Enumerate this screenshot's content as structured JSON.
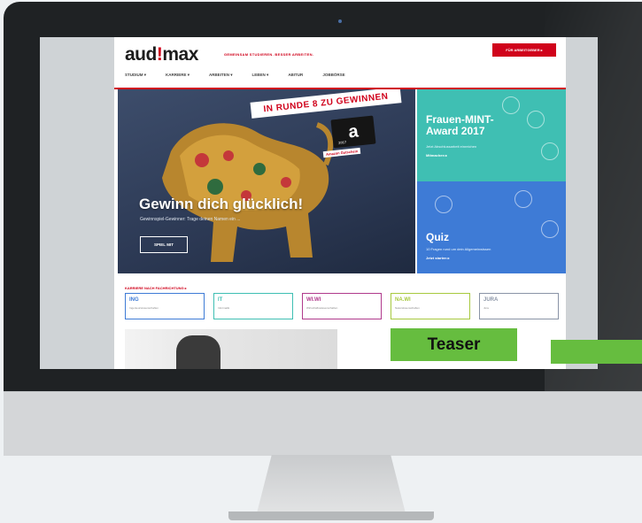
{
  "site": {
    "logo_main": "aud",
    "logo_bang": "!",
    "logo_end": "max",
    "tagline": "GEMEINSAM STUDIEREN. BESSER ARBEITEN.",
    "cta_label": "FÜR ARBEITGEBER ▸"
  },
  "nav": {
    "items": [
      {
        "label": "STUDIUM ▾"
      },
      {
        "label": "KARRIERE ▾"
      },
      {
        "label": "ARBEITEN ▾"
      },
      {
        "label": "LEBEN ▾"
      },
      {
        "label": "ABITUR"
      },
      {
        "label": "JOBBÖRSE"
      }
    ]
  },
  "hero": {
    "banner": "IN RUNDE 8 ZU GEWINNEN",
    "gift_symbol": "a",
    "gift_year": "2017",
    "gift_caption": "Amazon Gutschein",
    "title": "Gewinn dich glücklich!",
    "subtitle": "Gewinnspiel-Gewinner: Trage deinen Namen ein ...",
    "button": "SPIEL MIT"
  },
  "tiles": {
    "mint": {
      "title": "Frauen-MINT-Award 2017",
      "text": "Jetzt Abschlussarbeit einreichen",
      "more": "Mitmachen ▸"
    },
    "quiz": {
      "title": "Quiz",
      "text": "10 Fragen rund um dein Allgemeinwissen",
      "more": "Jetzt starten ▸"
    }
  },
  "filters": {
    "heading": "KARRIERE NACH FACHRICHTUNG ▸",
    "items": [
      {
        "code": "ING",
        "desc": "Ingenieurwissenschaften",
        "color": "#3e7bd6"
      },
      {
        "code": "IT",
        "desc": "Informatik",
        "color": "#3fbfb3"
      },
      {
        "code": "WI.WI",
        "desc": "Wirtschaftswissenschaften",
        "color": "#b03a8c"
      },
      {
        "code": "NA.WI",
        "desc": "Naturwissenschaften",
        "color": "#a7c93f"
      },
      {
        "code": "JURA",
        "desc": "Jura",
        "color": "#8a94a6"
      }
    ]
  },
  "overlay": {
    "teaser_label": "Teaser"
  },
  "colors": {
    "brand_red": "#d0021b",
    "overlay_green": "#66bd3f"
  }
}
